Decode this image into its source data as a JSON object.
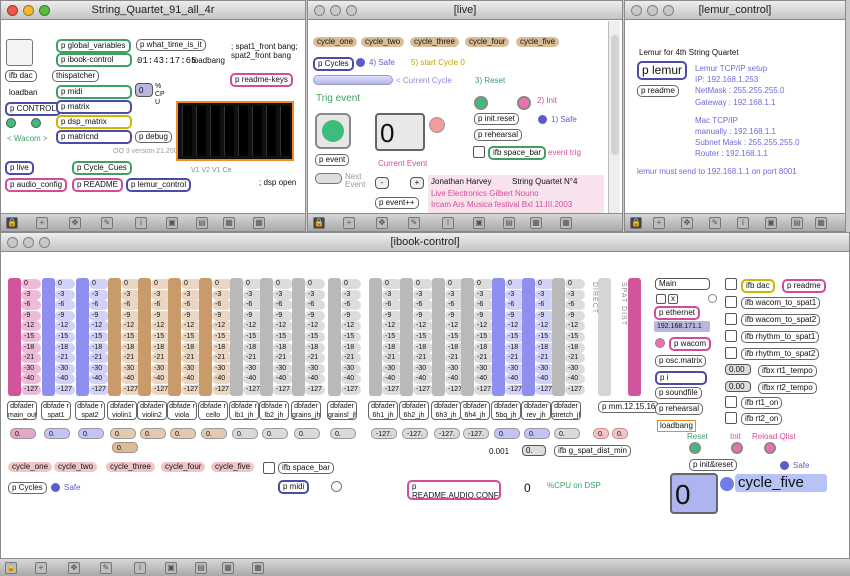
{
  "windows": {
    "main": {
      "title": "String_Quartet_91_all_4r"
    },
    "live": {
      "title": "[live]"
    },
    "lemur": {
      "title": "[lemur_control]"
    },
    "ibook": {
      "title": "[ibook-control]"
    }
  },
  "main": {
    "ifb_dac": "ifb dac",
    "global_variables": "p global_variables",
    "what_time": "p what_time_is_it",
    "spat1_bang": "; spat1_front bang; spat2_front bang",
    "ibook_control": "p ibook-control",
    "clock": "01:43:17:65",
    "loadbang1": "loadbang",
    "readme_keys": "p readme-keys",
    "loadban": "loadban",
    "thispatcher": "thispatcher",
    "p_midi": "p midi",
    "cpu_value": "0",
    "cpu_unit": "% CP U",
    "p_control": "p CONTROL",
    "p_matrix": "p matrix",
    "dsp_matrix": "p dsp_matrix",
    "wacom": "< Wacom >",
    "matricnd": "p matricnd",
    "debug": "p debug",
    "version": "OO 3 version 21.2005",
    "channel_labels": "V1 V2 V1 Ce",
    "p_live": "p live",
    "cycle_cues": "p Cycle_Cues",
    "dsp_open": "; dsp open",
    "audio_config": "p audio_config",
    "readme": "p README",
    "lemur_control": "p lemur_control"
  },
  "live": {
    "cycle_buttons": [
      "cycle_one",
      "cycle_two",
      "cycle_three",
      "cycle_four",
      "cycle_five"
    ],
    "p_cycles": "p Cycles",
    "safe4": "4) Safe",
    "start_cycle": "5) start Cycle 0",
    "current_cycle": "< Current Cycle",
    "reset": "3) Reset",
    "trig_event": "Trig event",
    "init2": "2) Init",
    "init_reset": "p init.reset",
    "safe1": "1) Safe",
    "big_number": "0",
    "rehearsal": "p rehearsal",
    "p_event": "p event",
    "current_event": "Current Event",
    "space_bar": "ifb space_bar",
    "event_trig": "event trig",
    "next_event": "Next Event",
    "minus": "-",
    "plus": "+",
    "event_pp": "p event++",
    "credit_composer": "Jonathan Harvey",
    "credit_title": "String Quartet N°4",
    "credit_line2": "Live Electronics Gilbert Nouno",
    "credit_line3": "Ircam Ars Musica festival Bxl 11.III.2003"
  },
  "lemur": {
    "heading": "Lemur for 4th String Quartet",
    "p_lemur": "p lemur",
    "setup": "Lemur TCP/IP setup",
    "ip": "IP: 192.168.1.253",
    "netmask": "NetMask : 255.255.255.0",
    "p_readme": "p readme",
    "gateway": "Gateway : 192.168.1.1",
    "mac_setup": "Mac TCP/IP",
    "manually": "manually : 192.168.1.1",
    "subnet": "Subnet Mask : 255.255.255.0",
    "router": "Router : 192.168.1.1",
    "note": "lemur must send to 192.168.1.1 on port 8001"
  },
  "ibook": {
    "ticks": [
      "0",
      "-3",
      "-6",
      "-9",
      "-12",
      "-15",
      "-18",
      "-21",
      "-30",
      "-40",
      "-127"
    ],
    "faders": [
      {
        "label": "dbfader main_out",
        "color": "#d0559b",
        "value": "0."
      },
      {
        "label": "dbfade r spat1",
        "color": "#8f8ff0",
        "value": "0."
      },
      {
        "label": "dbfade r spat2",
        "color": "#8f8ff0",
        "value": "0."
      },
      {
        "label": "dbfader violin1",
        "color": "#c99a6a",
        "value": "0."
      },
      {
        "label": "dbfader violin2",
        "color": "#c99a6a",
        "value": "0."
      },
      {
        "label": "dbfade r viola",
        "color": "#c99a6a",
        "value": "0."
      },
      {
        "label": "dbfade r cello",
        "color": "#c99a6a",
        "value": "0."
      },
      {
        "label": "dbfade r lb1_jh",
        "color": "#b9b9b9",
        "value": "0."
      },
      {
        "label": "dbfade r lb2_jh",
        "color": "#b9b9b9",
        "value": "0."
      },
      {
        "label": "dbfader grains_jh",
        "color": "#b9b9b9",
        "value": "0."
      },
      {
        "label": "dbfader grainsl_jh",
        "color": "#b9b9b9",
        "value": "0."
      },
      {
        "label": "dbfader 6h1_jh",
        "color": "#b9b9b9",
        "value": "-127."
      },
      {
        "label": "dbfader 6h2_jh",
        "color": "#b9b9b9",
        "value": "-127."
      },
      {
        "label": "dbfader 6h3_jh",
        "color": "#b9b9b9",
        "value": "-127."
      },
      {
        "label": "dbfader 6h4_jh",
        "color": "#b9b9b9",
        "value": "-127."
      },
      {
        "label": "dbfader 5bq_jh",
        "color": "#8f8ff0",
        "value": "0."
      },
      {
        "label": "dbfader rev_jh",
        "color": "#8f8ff0",
        "value": "0."
      },
      {
        "label": "dbfader stretch_jh",
        "color": "#b9b9b9",
        "value": "0."
      }
    ],
    "violin1_extra": "0.",
    "direct_label": "DIRECT",
    "spat_label": "SPAT DIST",
    "pmm": "p mm.12.15.16",
    "small_zero1": "0.",
    "small_zero2": "0.",
    "dist_value": "0.001",
    "dist_zero": "0.",
    "spat_dist_min": "ifb g_spat_dist_min",
    "cycle_buttons": [
      "cycle_one",
      "cycle_two",
      "cycle_three",
      "cycle_four",
      "cycle_five"
    ],
    "space_bar": "ifb space_bar",
    "p_cycles": "p Cycles",
    "safe": "Safe",
    "p_midi": "p midi",
    "readme_audio": "p README.AUDIO.CONFIG",
    "zero_val": "0",
    "cpu_dsp": "%CPU on DSP",
    "menu_main": "Main",
    "p_ethernet": "p ethernet",
    "ip": "192.168.171.1",
    "p_wacom": "p wacom",
    "osc_matrix": "p osc.matrix",
    "p_i": "p i",
    "soundfile": "p soundfile",
    "rehearsal": "p rehearsal",
    "loadbang": "loadbang",
    "reset": "Reset",
    "init": "Init",
    "reload": "Reload Qlist",
    "init_reset": "p init&reset",
    "safe2": "Safe",
    "big_number": "0",
    "cycle_display": "cycle_five",
    "ifb_dac": "ifb dac",
    "p_readme": "p readme",
    "wacom_spat1": "ifb wacom_to_spat1",
    "wacom_spat2": "ifb wacom_to_spat2",
    "rhythm_spat1": "ifb rhythm_to_spat1",
    "rhythm_spat2": "ifb rhythm_to_spat2",
    "val1": "0.00",
    "rt1_tempo": "ifbx rt1_tempo",
    "val2": "0.00",
    "rt2_tempo": "ifbx rt2_tempo",
    "rt1_on": "ifb rt1_on",
    "rt2_on": "ifb rt2_on"
  }
}
